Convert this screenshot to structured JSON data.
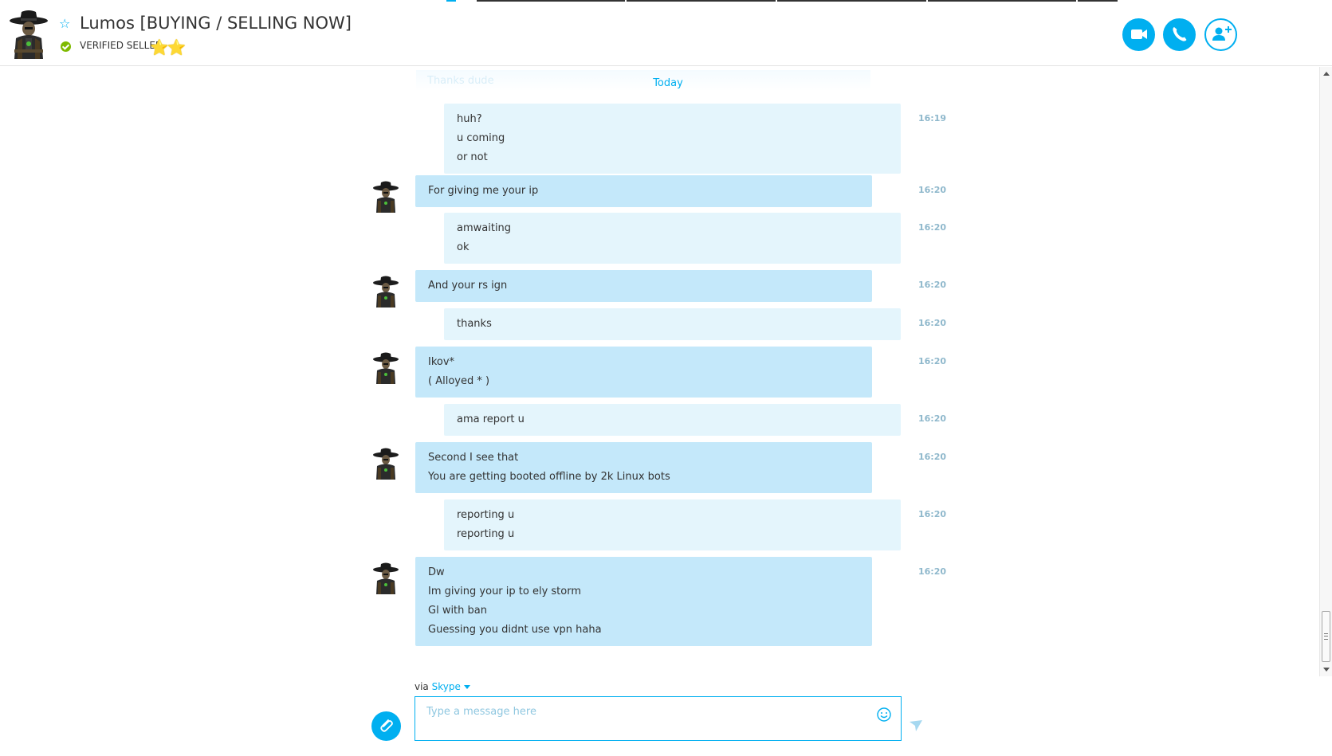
{
  "header": {
    "contact_name": "Lumos [BUYING / SELLING NOW]",
    "mood": "VERIFIED SELLER",
    "mood_emoji": "⭐⭐",
    "favorite_icon": "star-outline-icon",
    "status_icon": "online-check-icon",
    "buttons": {
      "video": "video-call-icon",
      "call": "phone-icon",
      "add": "add-contact-icon"
    }
  },
  "conversation": {
    "date_divider": "Today",
    "ghost_message": "Thanks dude",
    "messages": [
      {
        "direction": "outgoing",
        "time": "16:19",
        "lines": [
          "huh?",
          "u coming",
          "or not"
        ]
      },
      {
        "direction": "incoming",
        "time": "16:20",
        "lines": [
          "For giving me your ip"
        ]
      },
      {
        "direction": "outgoing",
        "time": "16:20",
        "lines": [
          "amwaiting",
          "ok"
        ]
      },
      {
        "direction": "incoming",
        "time": "16:20",
        "lines": [
          "And your rs ign"
        ]
      },
      {
        "direction": "outgoing",
        "time": "16:20",
        "lines": [
          "thanks"
        ]
      },
      {
        "direction": "incoming",
        "time": "16:20",
        "lines": [
          "Ikov*",
          "( Alloyed * )"
        ]
      },
      {
        "direction": "outgoing",
        "time": "16:20",
        "lines": [
          "ama report u"
        ]
      },
      {
        "direction": "incoming",
        "time": "16:20",
        "lines": [
          "Second I see that",
          "You are getting booted offline by 2k Linux bots"
        ]
      },
      {
        "direction": "outgoing",
        "time": "16:20",
        "lines": [
          "reporting u",
          "reporting u"
        ]
      },
      {
        "direction": "incoming",
        "time": "16:20",
        "lines": [
          "Dw",
          "Im giving your ip to ely storm",
          "Gl with ban",
          "Guessing you didnt use vpn haha"
        ]
      }
    ]
  },
  "compose": {
    "via_label": "via",
    "via_service": "Skype",
    "placeholder": "Type a message here"
  },
  "colors": {
    "accent": "#00aff0",
    "incoming_bubble": "#c4e8fa",
    "outgoing_bubble": "#e4f5fc",
    "timestamp": "#8fb8cc",
    "online": "#7fba00"
  }
}
